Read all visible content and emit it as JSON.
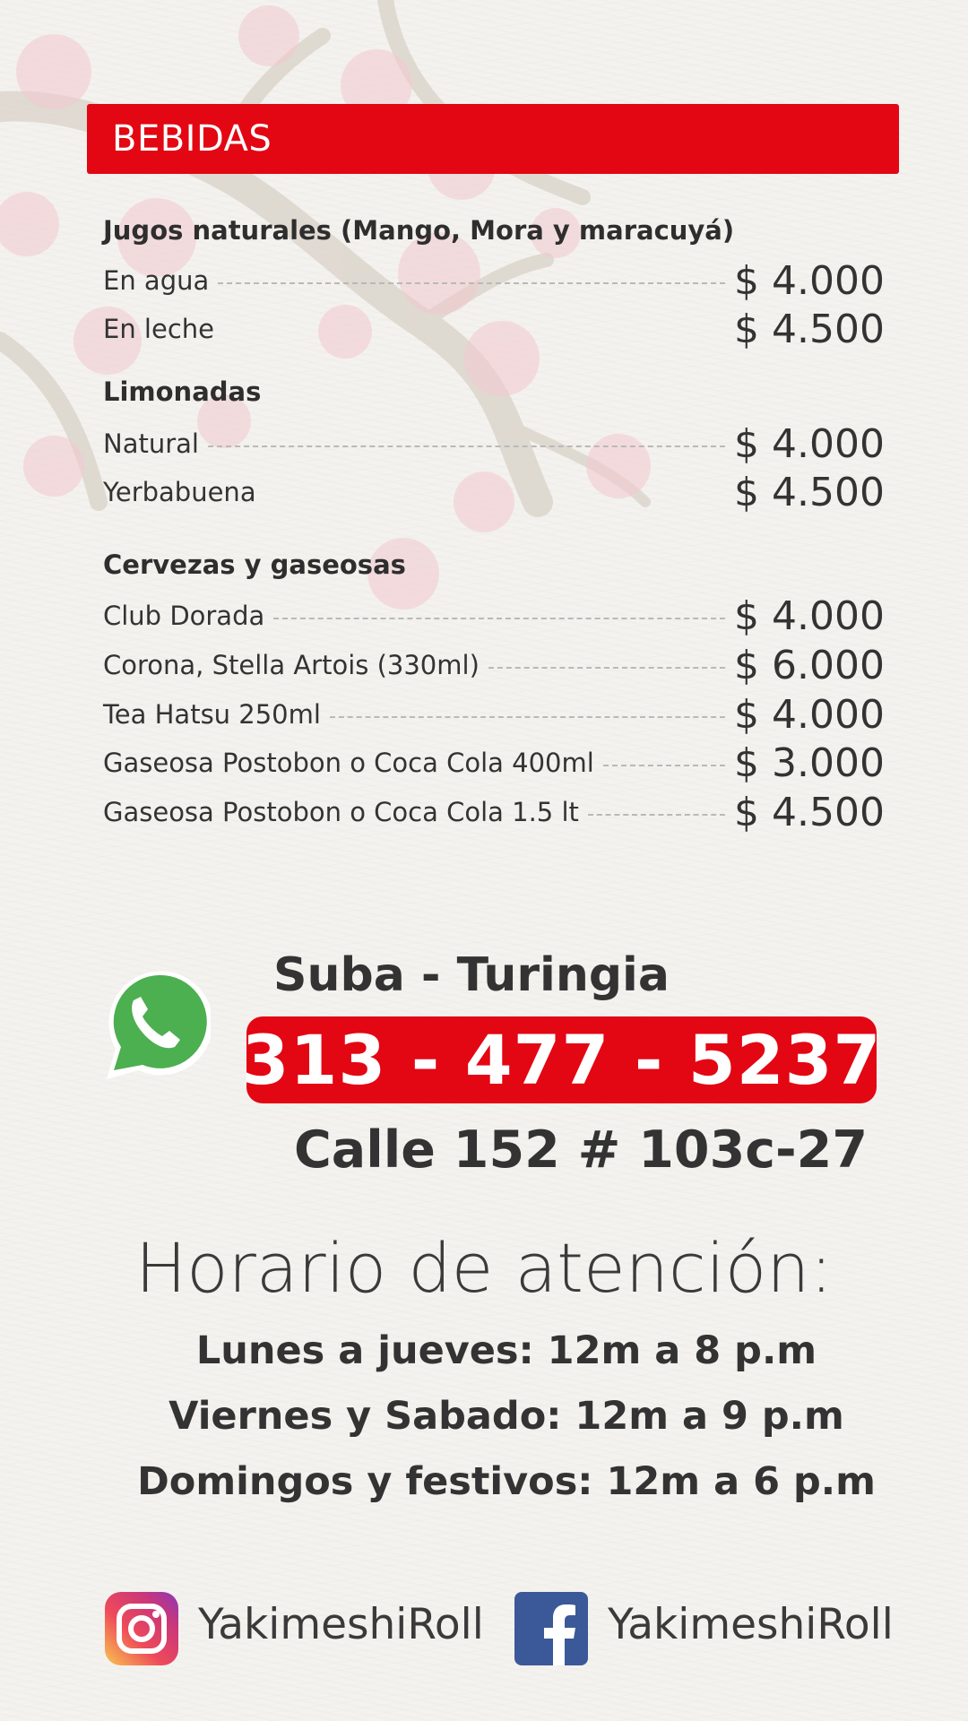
{
  "section": {
    "title": "BEBIDAS"
  },
  "categories": [
    {
      "title": "Jugos naturales (Mango, Mora y maracuyá)",
      "items": [
        {
          "name": "En agua",
          "price": "$ 4.000",
          "dotted": true
        },
        {
          "name": "En leche",
          "price": "$ 4.500",
          "dotted": false
        }
      ]
    },
    {
      "title": "Limonadas",
      "items": [
        {
          "name": "Natural",
          "price": "$ 4.000",
          "dotted": true
        },
        {
          "name": "Yerbabuena",
          "price": "$ 4.500",
          "dotted": false
        }
      ]
    },
    {
      "title": "Cervezas y gaseosas",
      "items": [
        {
          "name": "Club Dorada",
          "price": "$ 4.000",
          "dotted": true
        },
        {
          "name": "Corona, Stella Artois (330ml)",
          "price": "$ 6.000",
          "dotted": true
        },
        {
          "name": "Tea Hatsu 250ml",
          "price": "$ 4.000",
          "dotted": true
        },
        {
          "name": "Gaseosa Postobon o Coca Cola 400ml",
          "price": "$ 3.000",
          "dotted": true
        },
        {
          "name": "Gaseosa Postobon o Coca Cola 1.5 lt",
          "price": "$ 4.500",
          "dotted": true
        }
      ]
    }
  ],
  "contact": {
    "branch": "Suba - Turingia",
    "phone": "313 - 477 - 5237",
    "address": "Calle 152 # 103c-27"
  },
  "hours": {
    "title": "Horario de atención:",
    "lines": [
      "Lunes a jueves: 12m a 8 p.m",
      "Viernes y Sabado: 12m a 9 p.m",
      "Domingos y festivos: 12m a 6 p.m"
    ]
  },
  "social": {
    "instagram": {
      "handle": "YakimeshiRoll",
      "icon": "instagram-icon"
    },
    "facebook": {
      "handle": "YakimeshiRoll",
      "icon": "facebook-icon"
    }
  },
  "colors": {
    "accent": "#e30613",
    "text": "#333333",
    "whatsapp": "#4caf50",
    "facebook": "#3b5998",
    "background": "#f4f2ee"
  }
}
